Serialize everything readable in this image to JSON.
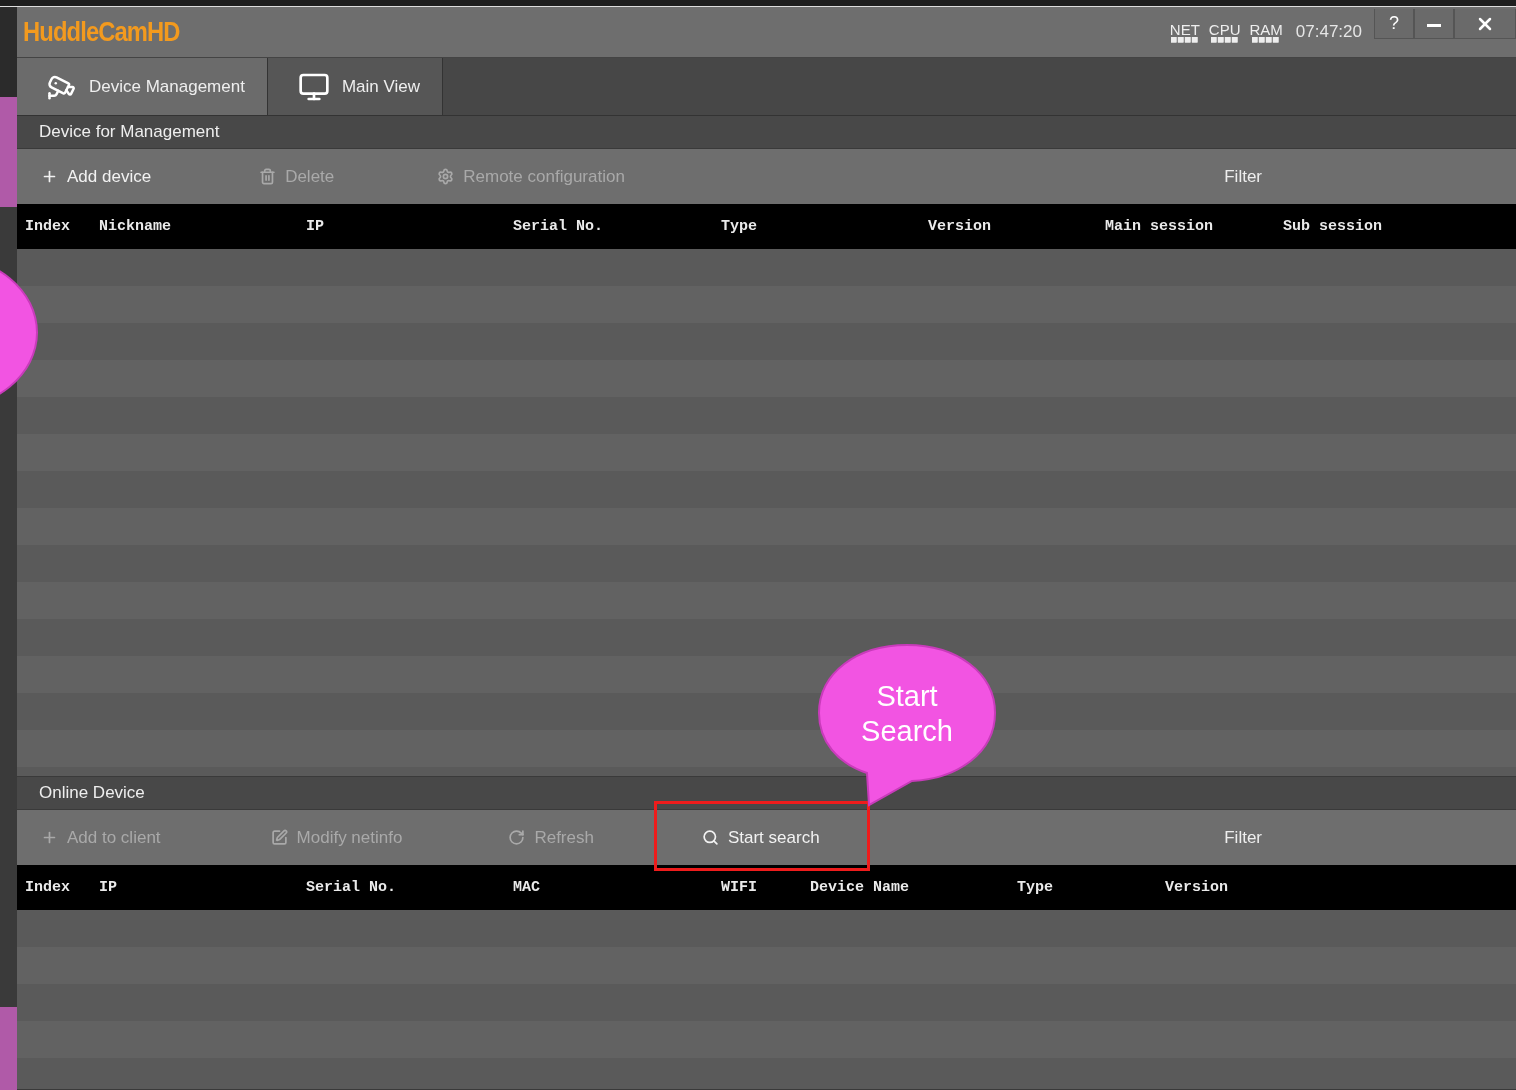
{
  "window": {
    "title": "HuddleCamHD",
    "meters": [
      {
        "label": "NET"
      },
      {
        "label": "CPU"
      },
      {
        "label": "RAM"
      }
    ],
    "clock": "07:47:20",
    "buttons": [
      {
        "kind": "help",
        "label": "?"
      },
      {
        "kind": "minimize"
      },
      {
        "kind": "close"
      }
    ]
  },
  "tabs": [
    {
      "label": "Device Management",
      "selected": true
    },
    {
      "label": "Main View",
      "selected": false
    }
  ],
  "managed_devices": {
    "title": "Device for Management",
    "toolbar": [
      {
        "label": "Add device",
        "disabled": false
      },
      {
        "label": "Delete",
        "disabled": true
      },
      {
        "label": "Remote configuration",
        "disabled": true
      }
    ],
    "filter": "Filter",
    "columns": [
      "Index",
      "Nickname",
      "IP",
      "Serial No.",
      "Type",
      "Version",
      "Main session",
      "Sub session"
    ]
  },
  "online_devices": {
    "title": "Online Device",
    "toolbar": [
      {
        "label": "Add to client",
        "disabled": true
      },
      {
        "label": "Modify netinfo",
        "disabled": true
      },
      {
        "label": "Refresh",
        "disabled": true
      },
      {
        "label": "Start search",
        "disabled": false,
        "highlighted": true
      }
    ],
    "filter": "Filter",
    "columns": [
      "Index",
      "IP",
      "Serial No.",
      "MAC",
      "WIFI",
      "Device Name",
      "Type",
      "Version"
    ]
  },
  "callout": {
    "text": "Start Search"
  }
}
